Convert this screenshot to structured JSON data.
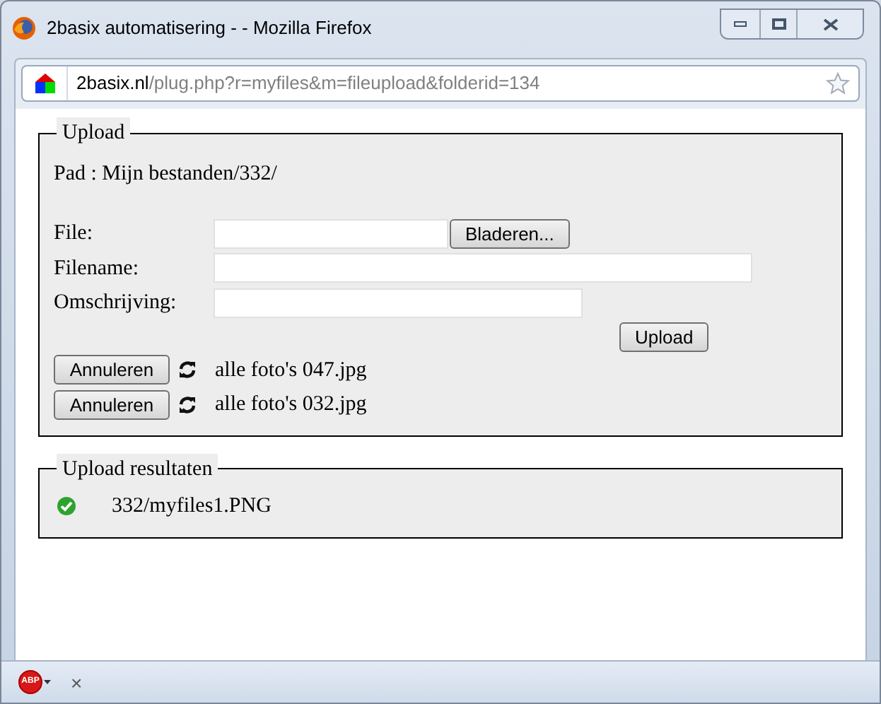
{
  "window": {
    "title": "2basix automatisering - - Mozilla Firefox"
  },
  "address_bar": {
    "domain": "2basix.nl",
    "path": "/plug.php?r=myfiles&m=fileupload&folderid=134"
  },
  "upload": {
    "legend": "Upload",
    "path_text": "Pad : Mijn bestanden/332/",
    "fields": [
      {
        "label": "File:",
        "kind": "file",
        "button": "Bladeren..."
      },
      {
        "label": "Filename:",
        "kind": "text"
      },
      {
        "label": "Omschrijving:",
        "kind": "text"
      }
    ],
    "upload_button": "Upload",
    "queue": [
      {
        "button": "Annuleren",
        "file": "alle foto's 047.jpg"
      },
      {
        "button": "Annuleren",
        "file": "alle foto's 032.jpg"
      }
    ]
  },
  "results": {
    "legend": "Upload resultaten",
    "items": [
      {
        "file": "332/myfiles1.PNG",
        "succeeded": true
      }
    ]
  },
  "status_bar": {
    "addon_badge": "ABP",
    "close": "×"
  }
}
